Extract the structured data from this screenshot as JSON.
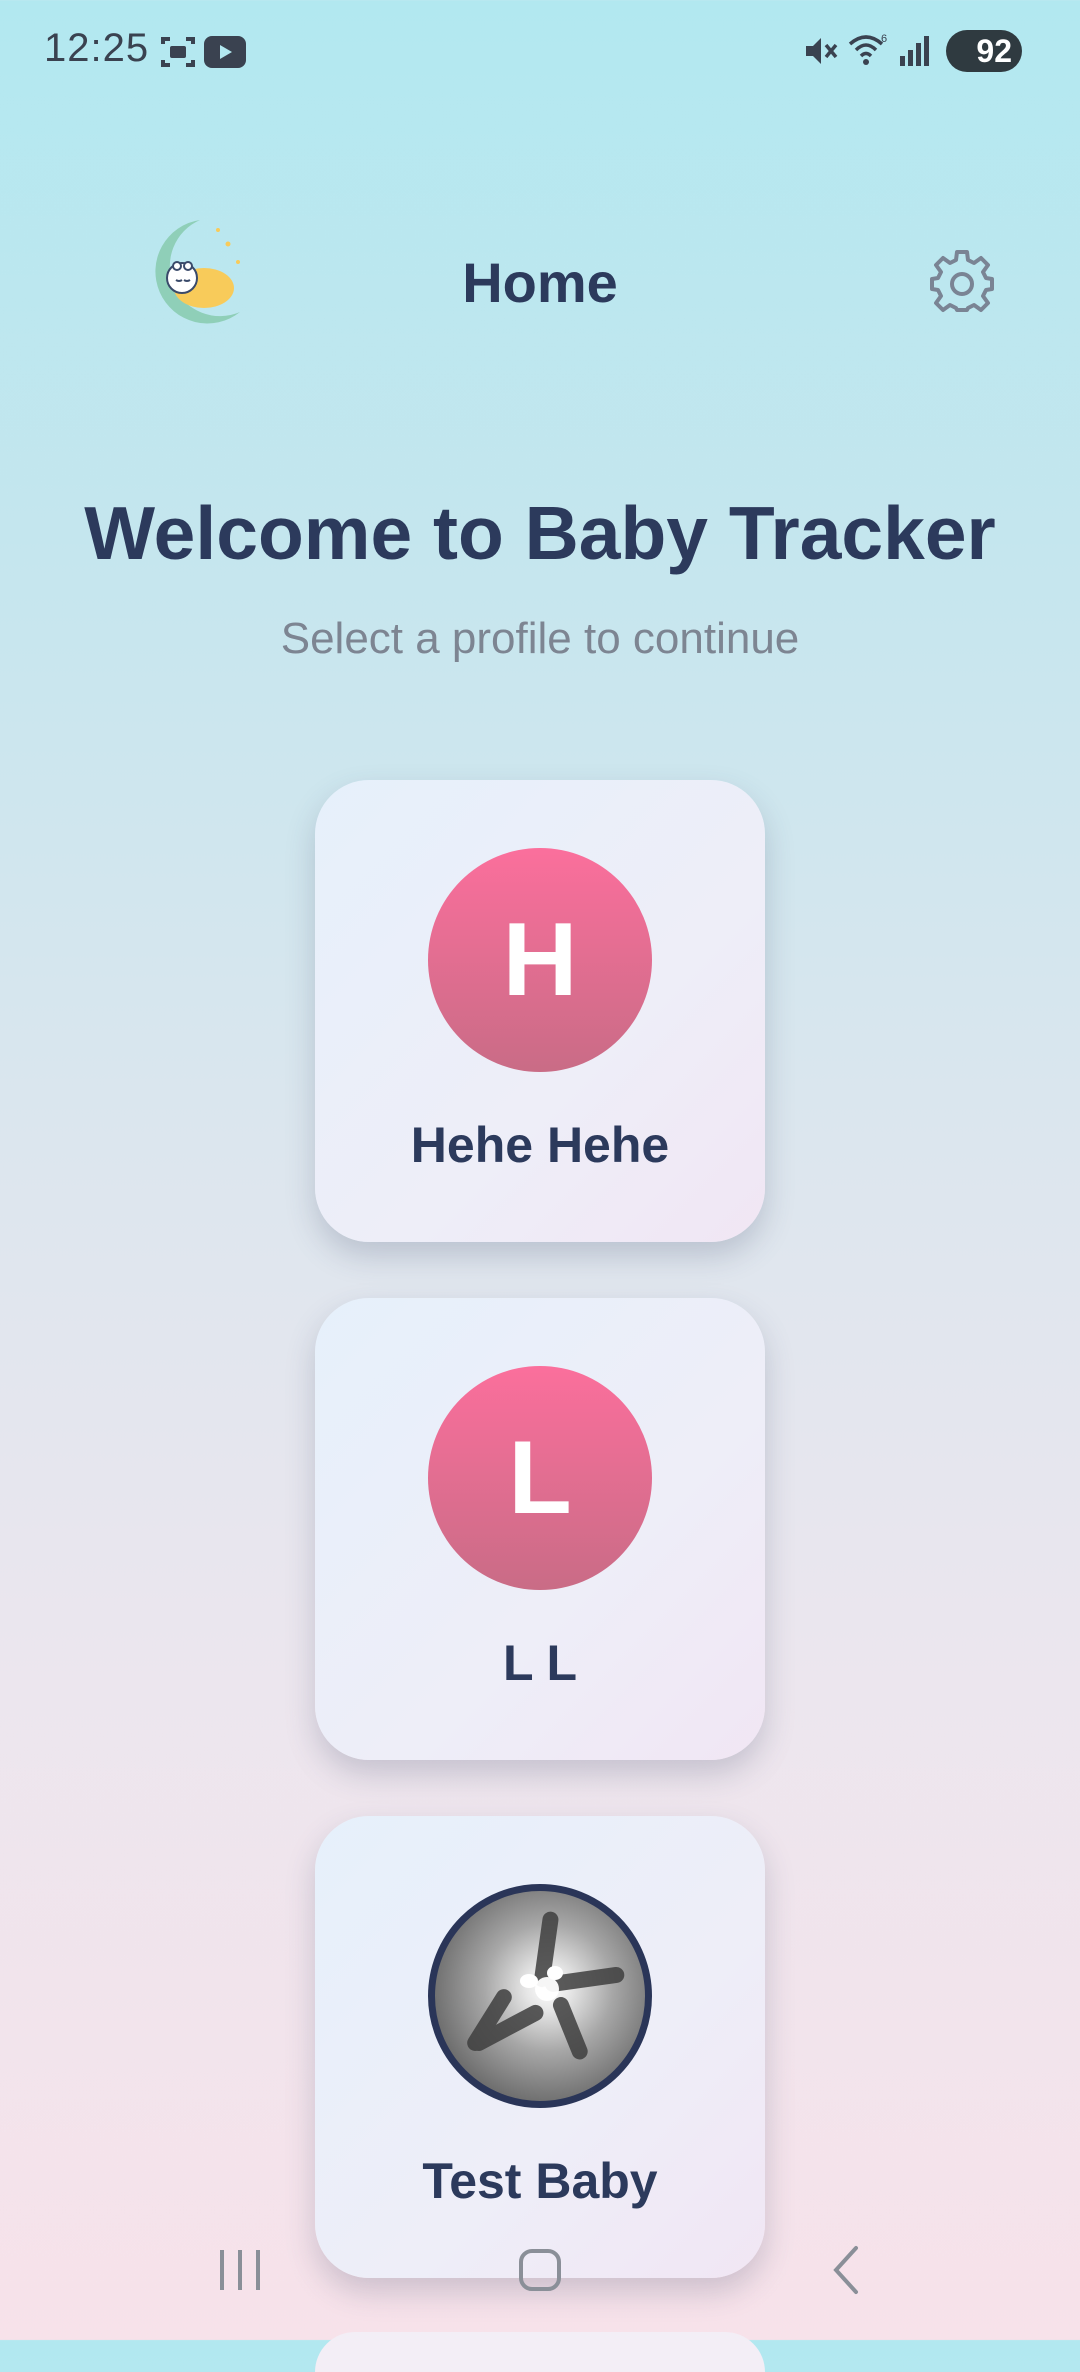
{
  "status_bar": {
    "time": "12:25",
    "battery": "92",
    "icons": [
      "screenshot-icon",
      "youtube-icon",
      "mute-icon",
      "wifi-icon",
      "signal-icon",
      "battery-icon"
    ]
  },
  "header": {
    "title": "Home",
    "logo_icon": "moon-baby-logo-icon",
    "settings_icon": "gear-icon"
  },
  "welcome": {
    "title": "Welcome to Baby Tracker",
    "subtitle": "Select a profile to continue"
  },
  "profiles": [
    {
      "initial": "H",
      "name": "Hehe Hehe"
    },
    {
      "initial": "L",
      "name": "L L"
    },
    {
      "initial": "",
      "name": "Test Baby",
      "avatar": "photo"
    }
  ],
  "nav_bar": {
    "icons": [
      "recents-icon",
      "home-icon",
      "back-icon"
    ]
  },
  "colors": {
    "title_text": "#2c3a5c",
    "subtitle_text": "#7d8592",
    "avatar_top": "#fb6f9c",
    "avatar_bottom": "#c96c86",
    "background_top": "#b2e8f0",
    "background_bottom": "#f7e2ea"
  }
}
